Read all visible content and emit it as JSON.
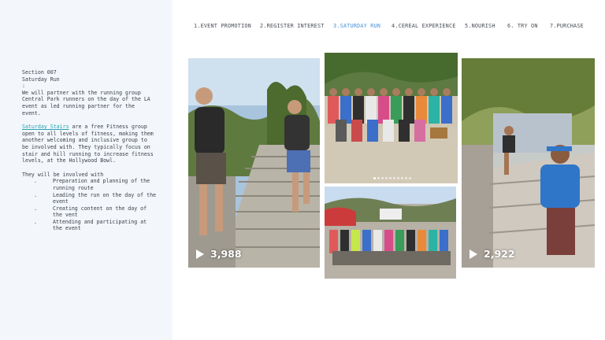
{
  "sidebar": {
    "section_label": "Section 007",
    "section_title": "Saturday Run",
    "colon": ":",
    "intro": "We will partner with the running group Central Park runners on the day of the LA event as led running partner for the event.",
    "partner_link": "Saturday Stairs",
    "partner_desc": " are a free Fitness group open to all levels of fitness, making them another welcoming and inclusive group to be involved with. They typically focus on stair and hill running to increase fitness levels, at the Hollywood Bowl.",
    "involved_heading": "They will be involved with",
    "bullet_marker": ".",
    "involved_items": [
      "Preparation and planning of the running route",
      "Leading the run on the day of the event",
      "Creating content on the day of the vent",
      "Attending and participating at the event"
    ]
  },
  "nav": {
    "items": [
      {
        "label": "1.EVENT PROMOTION"
      },
      {
        "label": "2.REGISTER INTEREST"
      },
      {
        "label": "3.SATURDAY RUN",
        "active": true
      },
      {
        "label": "4.CEREAL EXPERIENCE"
      },
      {
        "label": "5.NOURISH"
      },
      {
        "label": "6. TRY ON"
      },
      {
        "label": "7.PURCHASE"
      }
    ],
    "active_color": "#4a90d9"
  },
  "gallery": {
    "video1_views": "3,988",
    "video2_views": "2,922",
    "play_icon": "play-icon"
  }
}
